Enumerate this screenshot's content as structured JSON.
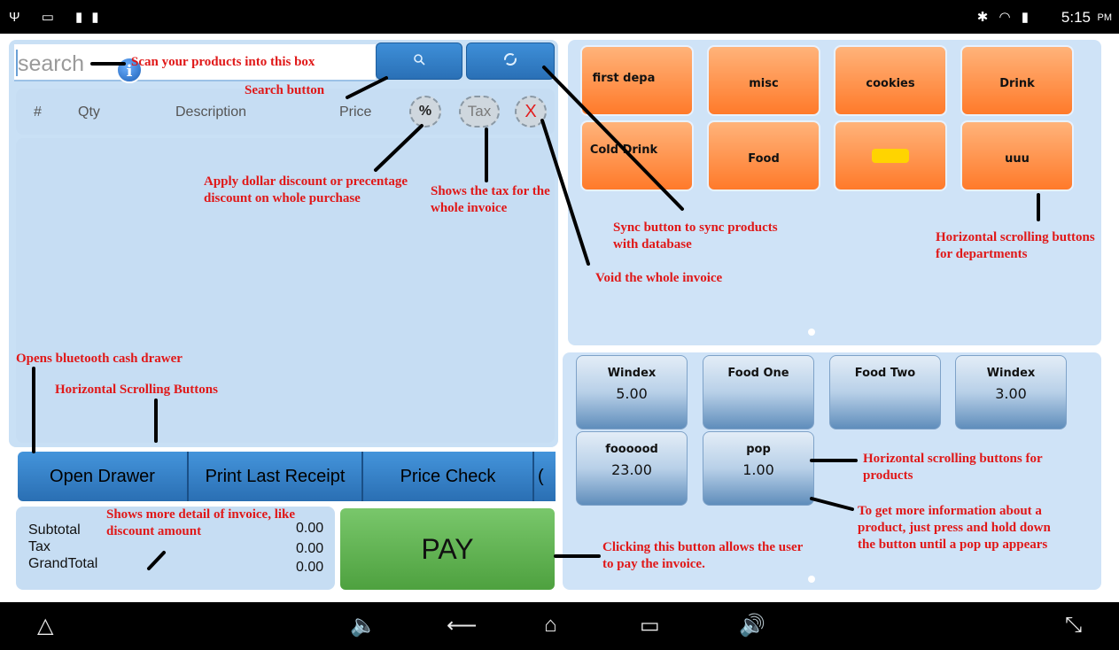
{
  "status_bar": {
    "left_icons": "Ψ ▭ ▮▮",
    "right_icons": "✱ ◠ ▮",
    "time": "5:15",
    "ampm": "PM"
  },
  "search": {
    "placeholder": "search"
  },
  "icons": {
    "search_btn": "search-icon",
    "sync_btn": "sync-icon"
  },
  "invoice_header": {
    "col_num": "#",
    "col_qty": "Qty",
    "col_description": "Description",
    "col_price": "Price",
    "discount_btn": "%",
    "tax_btn": "Tax",
    "void_btn": "X"
  },
  "function_buttons": {
    "open_drawer": "Open Drawer",
    "print_last": "Print Last Receipt",
    "price_check": "Price Check",
    "extra": "("
  },
  "totals": {
    "subtotal_label": "Subtotal",
    "subtotal": "0.00",
    "tax_label": "Tax",
    "tax": "0.00",
    "grandtotal_label": "GrandTotal",
    "grandtotal": "0.00",
    "info_icon": "i"
  },
  "pay_label": "PAY",
  "departments": [
    {
      "label": "first depa"
    },
    {
      "label": "misc"
    },
    {
      "label": "cookies"
    },
    {
      "label": "Drink"
    },
    {
      "label": "Cold Drink"
    },
    {
      "label": "Food"
    },
    {
      "label": ""
    },
    {
      "label": "uuu"
    }
  ],
  "products": [
    {
      "name": "Windex",
      "price": "5.00"
    },
    {
      "name": "Food One",
      "price": ""
    },
    {
      "name": "Food Two",
      "price": ""
    },
    {
      "name": "Windex",
      "price": "3.00"
    },
    {
      "name": "foooood",
      "price": "23.00"
    },
    {
      "name": "pop",
      "price": "1.00"
    }
  ],
  "annotations": {
    "scan": "Scan your products into this box",
    "search_button": "Search button",
    "discount": "Apply dollar discount or precentage discount on whole purchase",
    "tax": "Shows the tax for the whole invoice",
    "sync": "Sync button to sync products with database",
    "void": "Void the whole invoice",
    "dept_scroll": "Horizontal scrolling buttons for departments",
    "open_drawer": "Opens bluetooth cash drawer",
    "h_scroll": "Horizontal Scrolling Buttons",
    "prod_scroll": "Horizontal scrolling buttons for products",
    "more_detail": "Shows more detail of invoice, like discount amount",
    "pay": "Clicking this button allows the user to pay the invoice.",
    "product_info": "To get more information about a product, just press and hold down the button until a pop up appears"
  },
  "nav_bar": {
    "up": "△",
    "vol_down": "🔈",
    "back": "⟵",
    "home": "⌂",
    "recents": "▭",
    "vol_up": "🔊",
    "fullscreen": "⤡"
  },
  "colors": {
    "accent_blue": "#2a70b6",
    "pay_green": "#5cae4c",
    "dept_orange": "#ff7a2a",
    "annotation_red": "#e01818",
    "panel_bg": "#cfe3f7"
  }
}
